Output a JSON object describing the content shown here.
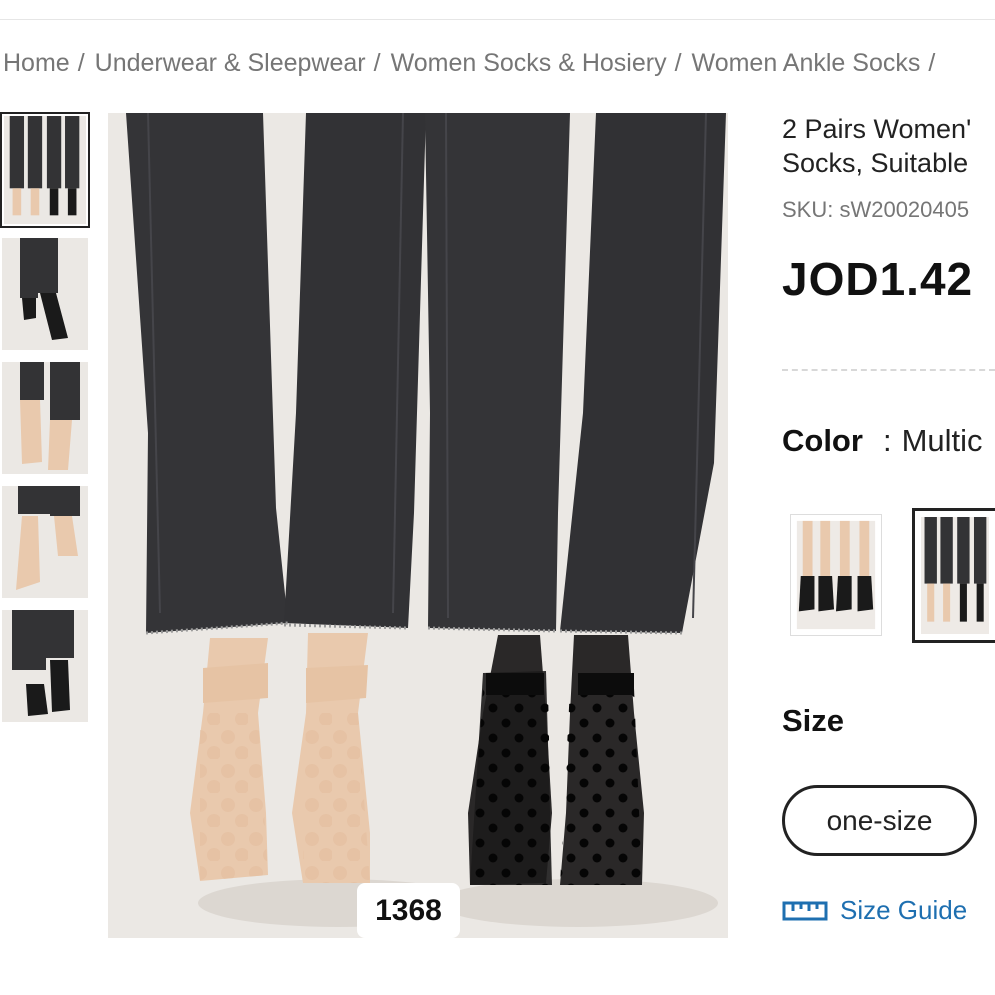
{
  "breadcrumb": {
    "items": [
      {
        "label": "Home"
      },
      {
        "label": "Underwear & Sleepwear"
      },
      {
        "label": "Women Socks & Hosiery"
      },
      {
        "label": "Women Ankle Socks"
      }
    ],
    "separator": "/"
  },
  "gallery": {
    "image_counter": "1368",
    "thumbnails": [
      "thumb-1",
      "thumb-2",
      "thumb-3",
      "thumb-4",
      "thumb-5"
    ],
    "active_thumbnail": 1
  },
  "product": {
    "title_line1": "2 Pairs Women'",
    "title_line2": "Socks, Suitable",
    "sku": "SKU: sW20020405",
    "price": "JOD1.42"
  },
  "color": {
    "label": "Color",
    "separator": ":",
    "value": "Multic"
  },
  "size": {
    "label": "Size",
    "options": [
      "one-size"
    ],
    "guide_label": "Size Guide"
  },
  "colors": {
    "denim": "#333335",
    "nude": "#e9c9ad",
    "black_sock": "#1a1a1a",
    "background": "#ebe8e4",
    "link": "#1e6fb0"
  }
}
